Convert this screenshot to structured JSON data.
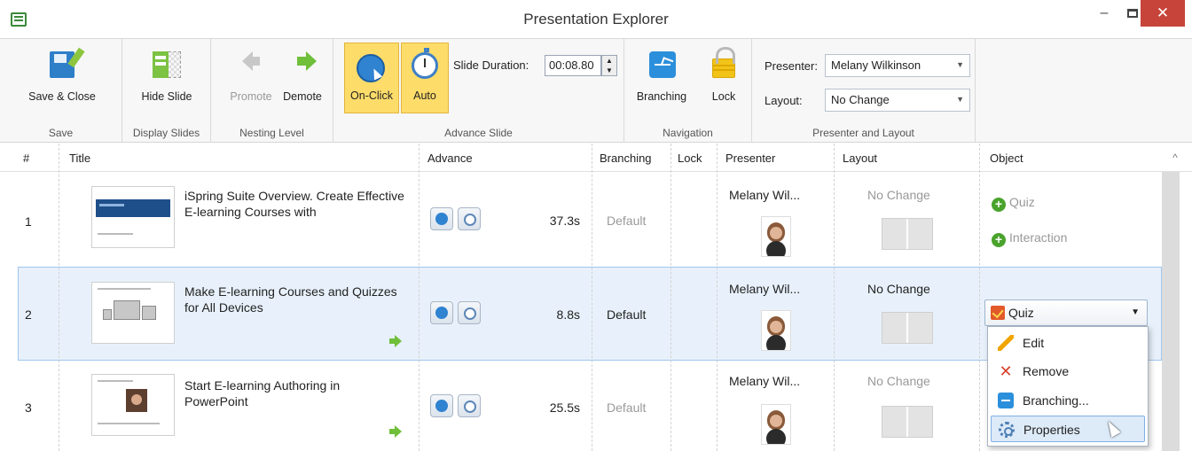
{
  "window": {
    "title": "Presentation Explorer",
    "minimize": "–",
    "close": "✕"
  },
  "ribbon": {
    "save_group": {
      "label": "Save",
      "save_close": "Save & Close"
    },
    "display_group": {
      "label": "Display Slides",
      "hide_slide": "Hide Slide"
    },
    "nesting_group": {
      "label": "Nesting Level",
      "promote": "Promote",
      "demote": "Demote"
    },
    "advance_group": {
      "label": "Advance Slide",
      "on_click": "On-Click",
      "auto": "Auto",
      "duration_label": "Slide Duration:",
      "duration_value": "00:08.80"
    },
    "navigation_group": {
      "label": "Navigation",
      "branching": "Branching",
      "lock": "Lock"
    },
    "presenter_group": {
      "label": "Presenter and Layout",
      "presenter_label": "Presenter:",
      "presenter_value": "Melany Wilkinson",
      "layout_label": "Layout:",
      "layout_value": "No Change"
    }
  },
  "table": {
    "headers": [
      "#",
      "Title",
      "Advance",
      "Branching",
      "Lock",
      "Presenter",
      "Layout",
      "Object"
    ],
    "rows": [
      {
        "num": "1",
        "title": "iSpring Suite Overview. Create Effective E-learning Courses with",
        "duration": "37.3s",
        "branching": "Default",
        "presenter": "Melany Wil...",
        "layout": "No Change",
        "objects": [
          "Quiz",
          "Interaction"
        ]
      },
      {
        "num": "2",
        "title": "Make E-learning Courses and Quizzes for All Devices",
        "duration": "8.8s",
        "branching": "Default",
        "presenter": "Melany Wil...",
        "layout": "No Change",
        "object_selected": "Quiz"
      },
      {
        "num": "3",
        "title": "Start E-learning Authoring in PowerPoint",
        "duration": "25.5s",
        "branching": "Default",
        "presenter": "Melany Wil...",
        "layout": "No Change"
      }
    ]
  },
  "context_menu": {
    "items": [
      "Edit",
      "Remove",
      "Branching...",
      "Properties"
    ]
  },
  "colors": {
    "accent": "#2f83d1",
    "active": "#fddc6a",
    "green": "#6fbf3a",
    "close": "#c7443b"
  }
}
